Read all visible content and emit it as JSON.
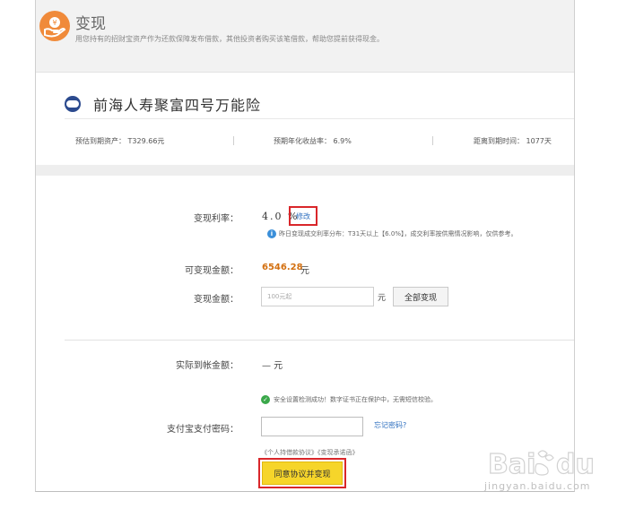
{
  "header": {
    "title": "变现",
    "description": "用您持有的招财宝资产作为还款保障发布借款，其他投资者购买该笔借款，帮助您提前获得现金。"
  },
  "product": {
    "name": "前海人寿聚富四号万能险"
  },
  "stats": {
    "asset": "预估到期资产：  T329.66元",
    "rate": "预期年化收益率：  6.9%",
    "days": "距离到期时间：  1077天"
  },
  "form": {
    "rate_label": "变现利率：",
    "rate_value": "4.0 %",
    "edit_label": "修改",
    "rate_hint": "昨日变现成交利率分布：T31天以上【6.0%】，成交利率按供需情况影响，仅供参考。",
    "available_label": "可变现金额：",
    "available_value": "6546.28",
    "available_unit": "元",
    "amount_label": "变现金额：",
    "amount_placeholder": "100元起",
    "amount_unit": "元",
    "all_button": "全部变现",
    "received_label": "实际到帐金额：",
    "received_value": "— 元",
    "security_msg": "安全设置检测成功！数字证书正在保护中，无需短信校验。",
    "password_label": "支付宝支付密码：",
    "forgot_link": "忘记密码?",
    "agreement_1": "《个人持借款协议》",
    "agreement_2": "《变现承诺函》",
    "submit_button": "同意协议并变现"
  },
  "watermark": {
    "text": "jingyan.baidu.com"
  },
  "colors": {
    "accent_orange": "#f08a3a",
    "amount_orange": "#d36f0f",
    "link_blue": "#2e6fbf",
    "highlight_red": "#d9262a",
    "submit_yellow": "#f6d52a"
  }
}
